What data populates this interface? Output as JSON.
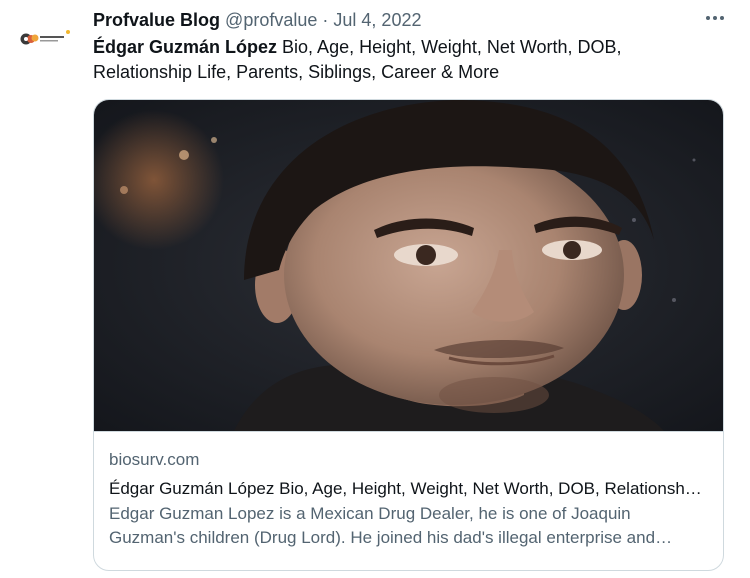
{
  "tweet": {
    "display_name": "Profvalue Blog",
    "handle": "@profvalue",
    "separator": "·",
    "date": "Jul 4, 2022",
    "text_bold": "Édgar Guzmán López",
    "text_rest": " Bio, Age, Height, Weight, Net Worth, DOB, Relationship Life, Parents, Siblings, Career & More",
    "more_icon": "more-horizontal-icon"
  },
  "card": {
    "domain": "biosurv.com",
    "title": "Édgar Guzmán López  Bio, Age, Height, Weight, Net Worth, DOB, Relationship Life, Parents, Siblings, Career & More",
    "description": "Edgar Guzman Lopez is a Mexican Drug Dealer, he is one of Joaquin Guzman's children (Drug Lord). He joined his dad's illegal enterprise and became a significant figure in the organization."
  },
  "colors": {
    "text_primary": "#0f1419",
    "text_secondary": "#536471",
    "border": "#cfd9de"
  }
}
